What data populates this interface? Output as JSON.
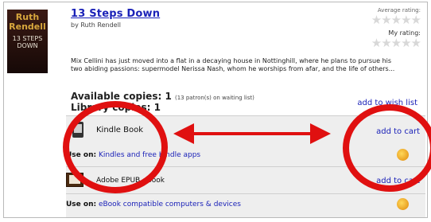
{
  "book": {
    "title": "13 Steps Down",
    "byline": "by Ruth Rendell",
    "cover": {
      "author": "Ruth Rendell",
      "title": "13 STEPS DOWN"
    },
    "description": "Mix Cellini has just moved into a flat in a decaying house in Nottinghill, where he plans to pursue his two abiding passions: supermodel Nerissa Nash, whom he worships from afar, and the life of others...",
    "average_rating_label": "Average rating:",
    "my_rating_label": "My rating:",
    "stars_avg": "★★★★★",
    "stars_mine": "★★★★★"
  },
  "availability": {
    "available_label": "Available copies:",
    "available_count": "1",
    "waiting_note": "(13 patron(s) on waiting list)",
    "library_label": "Library copies:",
    "library_count": "1",
    "wish_list": "add to wish list"
  },
  "formats": [
    {
      "name": "Kindle Book",
      "cart": "add to cart",
      "use_label": "Use on:",
      "use_link": "Kindles and free Kindle apps"
    },
    {
      "name": "Adobe EPUB eBook",
      "cart": "add to cart",
      "use_label": "Use on:",
      "use_link": "eBook compatible computers & devices"
    }
  ],
  "colors": {
    "link": "#1b22b8",
    "annotation_red": "#e01010",
    "panel_bg": "#eeeeee"
  }
}
